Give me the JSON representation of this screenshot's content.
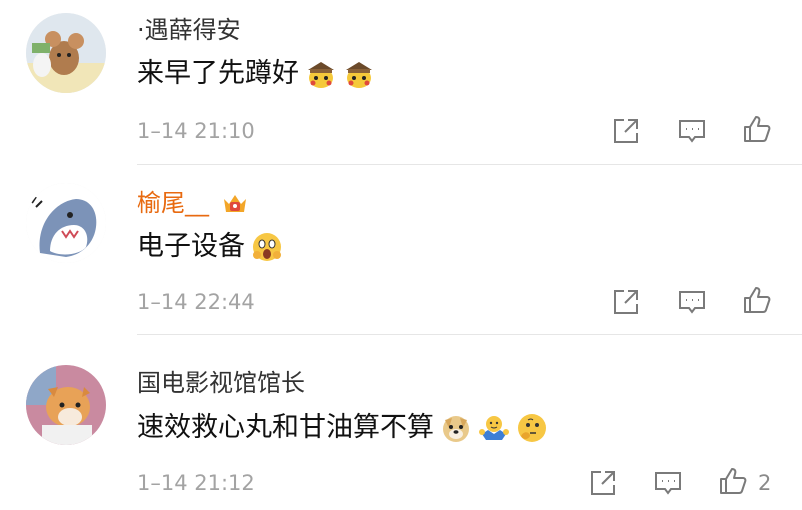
{
  "comments": [
    {
      "username": "·遇薛得安",
      "text": "来早了先蹲好",
      "emojis": [
        "detective-pikachu-emoji",
        "detective-pikachu-emoji"
      ],
      "time": "1–14 21:10",
      "likes": ""
    },
    {
      "username": "榆尾__",
      "badge": "crown-badge-icon",
      "text": "电子设备",
      "emojis": [
        "shocked-face-emoji"
      ],
      "time": "1–14 22:44",
      "likes": ""
    },
    {
      "username": "国电影视馆馆长",
      "text": "速效救心丸和甘油算不算",
      "emojis": [
        "doge-emoji",
        "shrug-emoji",
        "thinking-face-emoji"
      ],
      "time": "1–14 21:12",
      "likes": "2"
    }
  ],
  "colors": {
    "username_orange": "#e86a10",
    "time_gray": "#a3a3a3",
    "icon_gray": "#7a7a7a"
  }
}
